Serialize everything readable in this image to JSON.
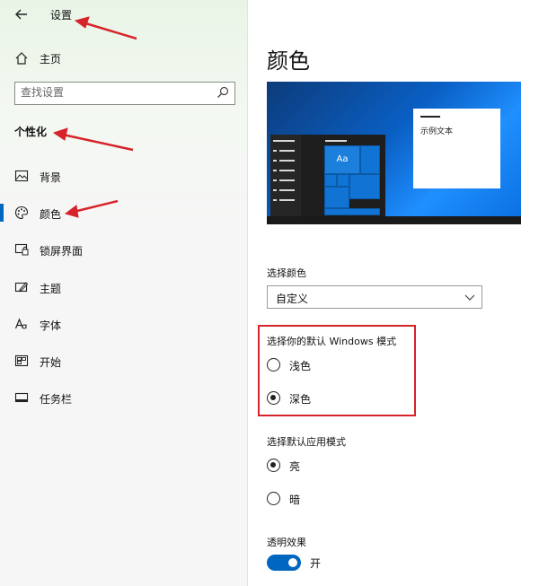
{
  "sidebar": {
    "title": "设置",
    "home_label": "主页",
    "search_placeholder": "查找设置",
    "section_title": "个性化",
    "items": [
      {
        "label": "背景",
        "icon": "image-icon"
      },
      {
        "label": "颜色",
        "icon": "palette-icon",
        "selected": true
      },
      {
        "label": "锁屏界面",
        "icon": "lock-screen-icon"
      },
      {
        "label": "主题",
        "icon": "theme-icon"
      },
      {
        "label": "字体",
        "icon": "font-icon"
      },
      {
        "label": "开始",
        "icon": "start-icon"
      },
      {
        "label": "任务栏",
        "icon": "taskbar-icon"
      }
    ]
  },
  "main": {
    "title": "颜色",
    "preview": {
      "sample_text": "示例文本",
      "tile_text": "Aa"
    },
    "choose_color": {
      "label": "选择颜色",
      "value": "自定义"
    },
    "windows_mode": {
      "label": "选择你的默认 Windows 模式",
      "options": [
        "浅色",
        "深色"
      ],
      "selected": "深色"
    },
    "app_mode": {
      "label": "选择默认应用模式",
      "options": [
        "亮",
        "暗"
      ],
      "selected": "亮"
    },
    "transparency": {
      "label": "透明效果",
      "state_label": "开",
      "on": true
    }
  },
  "colors": {
    "accent": "#0067c0",
    "annotation": "#d6242a"
  }
}
